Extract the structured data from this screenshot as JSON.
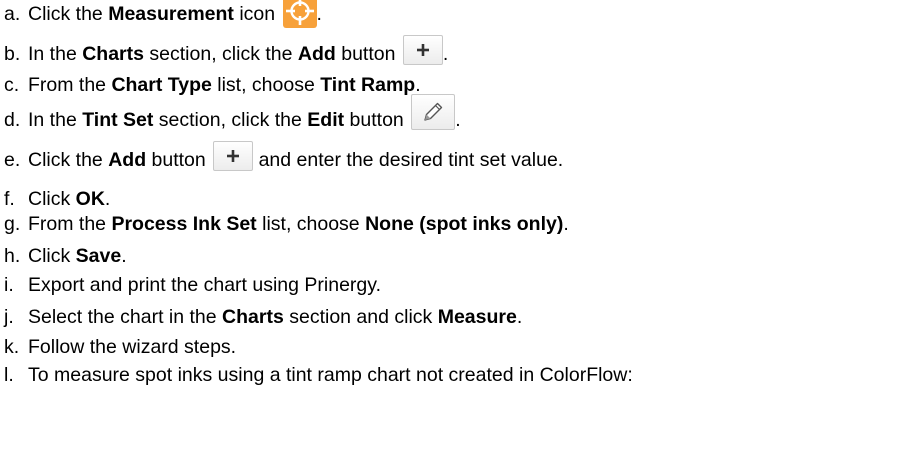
{
  "steps": [
    {
      "marker": "a.",
      "segments": [
        {
          "t": "Click the "
        },
        {
          "t": "Measurement",
          "b": true
        },
        {
          "t": " icon "
        },
        {
          "icon": "measurement-icon"
        },
        {
          "t": "."
        }
      ]
    },
    {
      "marker": "b.",
      "segments": [
        {
          "t": "In the "
        },
        {
          "t": "Charts",
          "b": true
        },
        {
          "t": " section, click the "
        },
        {
          "t": "Add",
          "b": true
        },
        {
          "t": " button "
        },
        {
          "icon": "add-icon"
        },
        {
          "t": "."
        }
      ]
    },
    {
      "marker": "c.",
      "segments": [
        {
          "t": "From the "
        },
        {
          "t": "Chart Type",
          "b": true
        },
        {
          "t": " list, choose "
        },
        {
          "t": "Tint Ramp",
          "b": true
        },
        {
          "t": "."
        }
      ]
    },
    {
      "marker": "d.",
      "segments": [
        {
          "t": "In the "
        },
        {
          "t": "Tint Set",
          "b": true
        },
        {
          "t": " section, click the "
        },
        {
          "t": "Edit",
          "b": true
        },
        {
          "t": " button "
        },
        {
          "icon": "pencil-icon"
        },
        {
          "t": "."
        }
      ]
    },
    {
      "marker": "e.",
      "segments": [
        {
          "t": "Click the "
        },
        {
          "t": "Add",
          "b": true
        },
        {
          "t": " button "
        },
        {
          "icon": "add-icon"
        },
        {
          "t": " and enter the desired tint set value."
        }
      ]
    },
    {
      "marker": "f.",
      "segments": [
        {
          "t": "Click "
        },
        {
          "t": "OK",
          "b": true
        },
        {
          "t": "."
        }
      ]
    },
    {
      "marker": "g.",
      "segments": [
        {
          "t": "From the "
        },
        {
          "t": "Process Ink Set",
          "b": true
        },
        {
          "t": " list, choose "
        },
        {
          "t": "None (spot inks only)",
          "b": true
        },
        {
          "t": "."
        }
      ]
    },
    {
      "marker": "h.",
      "segments": [
        {
          "t": "Click "
        },
        {
          "t": "Save",
          "b": true
        },
        {
          "t": "."
        }
      ]
    },
    {
      "marker": "i.",
      "segments": [
        {
          "t": "Export and print the chart using Prinergy."
        }
      ]
    },
    {
      "marker": "j.",
      "segments": [
        {
          "t": "Select the chart in the "
        },
        {
          "t": "Charts",
          "b": true
        },
        {
          "t": " section and click "
        },
        {
          "t": "Measure",
          "b": true
        },
        {
          "t": "."
        }
      ]
    },
    {
      "marker": "k.",
      "segments": [
        {
          "t": "Follow the wizard steps."
        }
      ]
    },
    {
      "marker": "l.",
      "segments": [
        {
          "t": "To measure spot inks using a tint ramp chart not created in ColorFlow:"
        }
      ]
    }
  ],
  "colors": {
    "measurement_icon": "#f7a13a",
    "text": "#000000"
  }
}
